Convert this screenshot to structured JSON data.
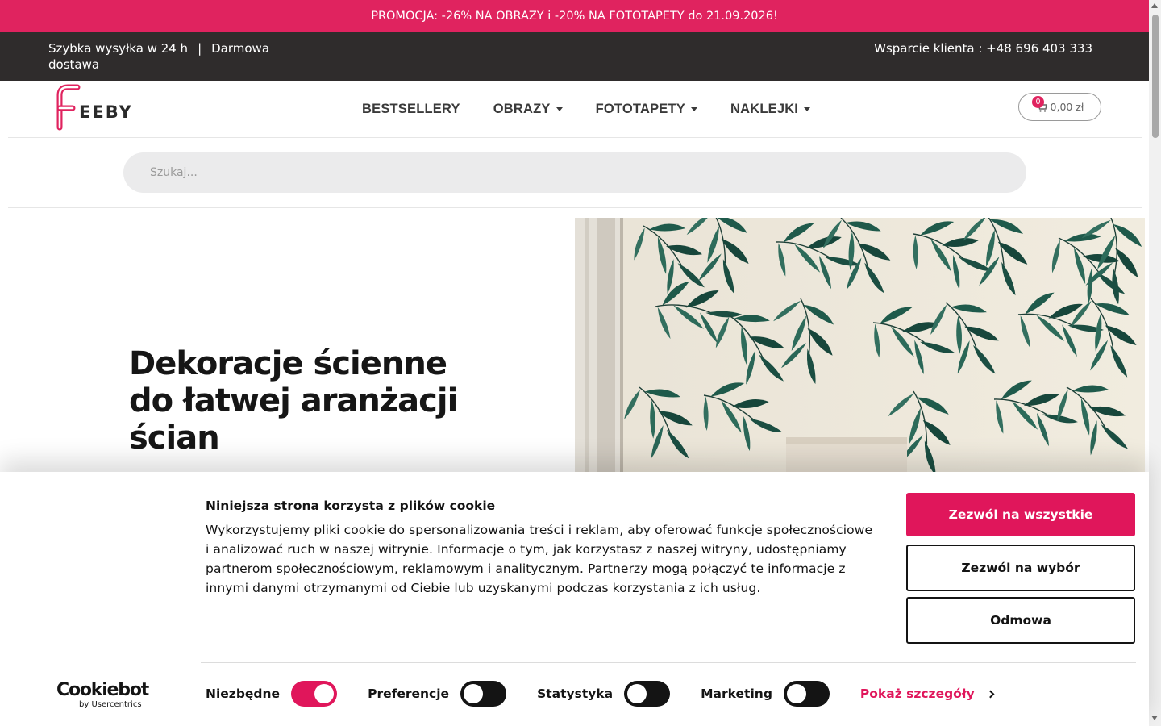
{
  "promo": {
    "text": "PROMOCJA: -26% NA OBRAZY i -20% NA FOTOTAPETY do 21.09.2026!"
  },
  "topbar": {
    "shipping": "Szybka wysyłka w 24 h",
    "separator": "|",
    "free_delivery": "Darmowa dostawa",
    "support": "Wsparcie klienta : +48 696 403 333"
  },
  "header": {
    "logo_text": "EEBY",
    "nav": [
      {
        "label": "BESTSELLERY",
        "dropdown": false
      },
      {
        "label": "OBRAZY",
        "dropdown": true
      },
      {
        "label": "FOTOTAPETY",
        "dropdown": true
      },
      {
        "label": "NAKLEJKI",
        "dropdown": true
      }
    ],
    "cart": {
      "count": "0",
      "total": "0,00 zł"
    }
  },
  "search": {
    "placeholder": "Szukaj..."
  },
  "hero": {
    "title": "Dekoracje ścienne do łatwej aranżacji ścian"
  },
  "cookie": {
    "title": "Niniejsza strona korzysta z plików cookie",
    "text": "Wykorzystujemy pliki cookie do spersonalizowania treści i reklam, aby oferować funkcje społecznościowe i analizować ruch w naszej witrynie. Informacje o tym, jak korzystasz z naszej witryny, udostępniamy partnerom społecznościowym, reklamowym i analitycznym. Partnerzy mogą połączyć te informacje z innymi danymi otrzymanymi od Ciebie lub uzyskanymi podczas korzystania z ich usług.",
    "allow_all": "Zezwól na wszystkie",
    "allow_selection": "Zezwól na wybór",
    "deny": "Odmowa",
    "brand_main": "Cookiebot",
    "brand_sub": "by Usercentrics",
    "toggles": [
      {
        "label": "Niezbędne",
        "on": true
      },
      {
        "label": "Preferencje",
        "on": false
      },
      {
        "label": "Statystyka",
        "on": false
      },
      {
        "label": "Marketing",
        "on": false
      }
    ],
    "show_details": "Pokaż szczegóły"
  },
  "colors": {
    "brand": "#e0235f",
    "topbar": "#2f2c2c",
    "leaf": "#1f5a4b"
  }
}
